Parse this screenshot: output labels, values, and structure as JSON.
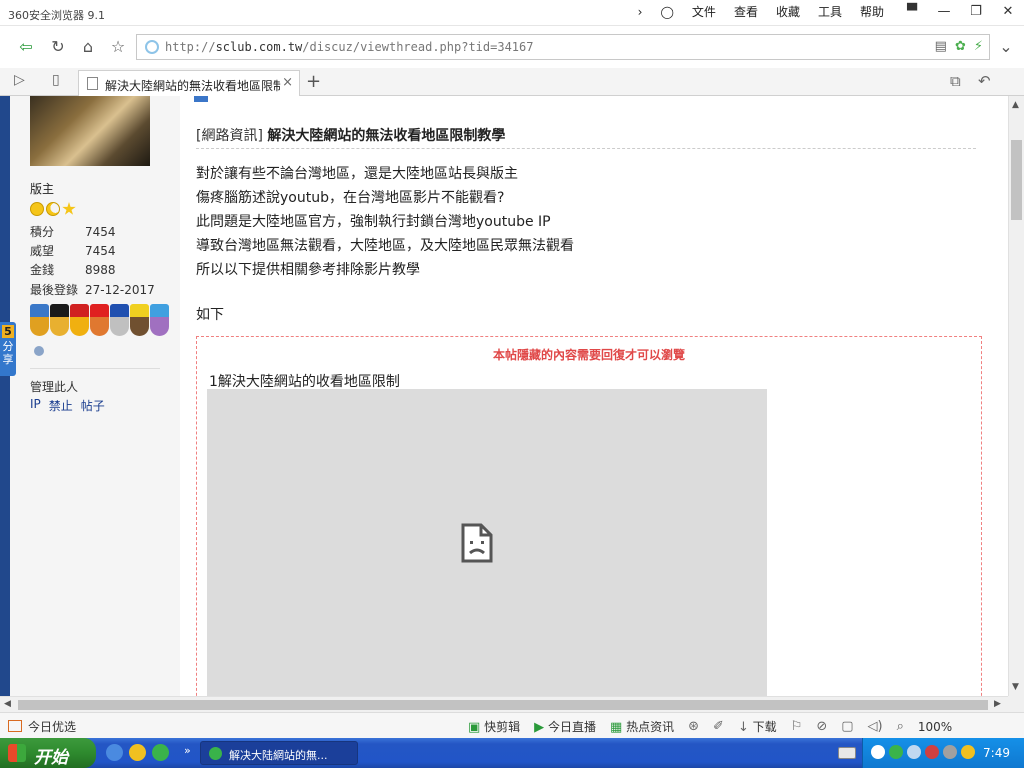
{
  "browser": {
    "app_title": "360安全浏览器 9.1",
    "menus": [
      "文件",
      "查看",
      "收藏",
      "工具",
      "帮助"
    ],
    "url_prefix": "http://",
    "url_domain": "sclub.com.tw",
    "url_path": "/discuz/viewthread.php?tid=34167",
    "tab_title": "解決大陸網站的無法收看地區限制",
    "zoom": "100%"
  },
  "sidebar": {
    "role": "版主",
    "stats": [
      {
        "label": "積分",
        "value": "7454"
      },
      {
        "label": "威望",
        "value": "7454"
      },
      {
        "label": "金錢",
        "value": "8988"
      },
      {
        "label": "最後登錄",
        "value": "27-12-2017"
      }
    ],
    "manage_title": "管理此人",
    "manage_links": [
      "IP",
      "禁止",
      "帖子"
    ],
    "share_label": "分享",
    "share_num": "5"
  },
  "post": {
    "category": "[網路資訊]",
    "title": "解決大陸網站的無法收看地區限制教學",
    "lines": [
      "對於讓有些不論台灣地區，還是大陸地區站長與版主",
      "傷疼腦筋述說youtub，在台灣地區影片不能觀看?",
      "此問題是大陸地區官方，強制執行封鎖台灣地youtube IP",
      "導致台灣地區無法觀看，大陸地區，及大陸地區民眾無法觀看",
      "所以以下提供相關參考排除影片教學"
    ],
    "rulu": "如下",
    "hidden_notice": "本帖隱藏的內容需要回復才可以瀏覽",
    "hidden_sub": "1解決大陸網站的收看地區限制"
  },
  "statusbar": {
    "today": "今日优选",
    "items": [
      "快剪辑",
      "今日直播",
      "热点资讯",
      "下载"
    ]
  },
  "taskbar": {
    "start": "开始",
    "task_title": "解决大陆網站的無...",
    "clock": "7:49"
  }
}
